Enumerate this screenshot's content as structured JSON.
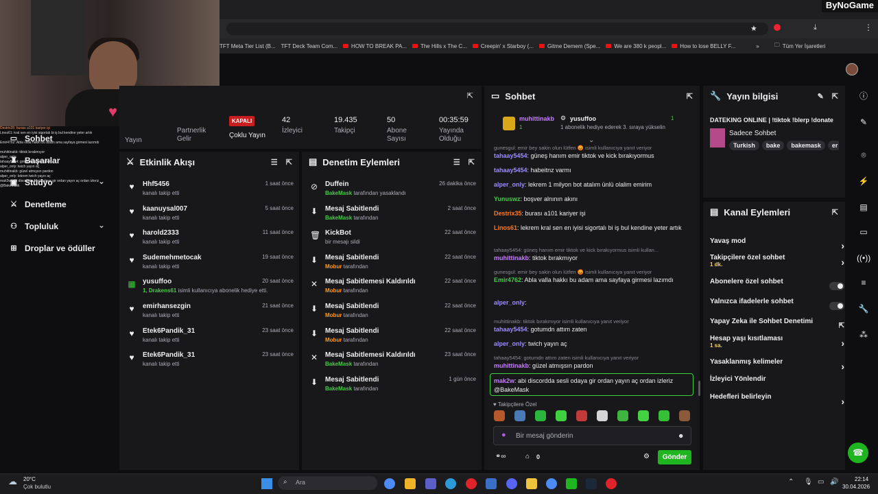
{
  "brand_watermark": "ByNoGame",
  "bookmarks": [
    "TFT Meta Tier List (B...",
    "TFT Deck Team Com...",
    "HOW TO BREAK PA...",
    "The Hills x The C...",
    "Creepin' x Starboy (...",
    "Gitme Demem (Spe...",
    "We are 380 k peopl...",
    "How to lose BELLY F..."
  ],
  "all_bookmarks": "Tüm Yer İşaretleri",
  "sidebar": {
    "items": [
      {
        "label": "Sohbet",
        "icon": "chat-icon"
      },
      {
        "label": "Başarılar",
        "icon": "trophy-icon"
      },
      {
        "label": "Stüdyo",
        "icon": "studio-icon"
      },
      {
        "label": "Denetleme",
        "icon": "sword-icon"
      },
      {
        "label": "Topluluk",
        "icon": "community-icon"
      },
      {
        "label": "Droplar ve ödüller",
        "icon": "gift-icon"
      }
    ],
    "overlay_chat": [
      "Destrix35: burası a101 kariyer işi",
      "Linos61: kral sen en iyisi sigortalı bi iş bul kendine yeter artık",
      "Emir4762: Abla valla hakkı bu adam ama sayfaya girmesi lazımdı",
      "muhittinakb: tiktok bırakmıyor",
      "alper_only:",
      "tahaay5454: gotumdn attım zaten",
      "alper_only: twich yayın aç",
      "muhittinakb: güzel atmışsın pardon",
      "alper_only: lekrem twich yayın aç",
      "mak2w: abi discordda sesli odaya gir ordan yayın aç ordan izleriz @BakeMask"
    ]
  },
  "stream_stats": {
    "partial_label": "Yayın",
    "partner_label": "Partnerlik Gelir",
    "multistream_badge": "KAPALI",
    "multistream_label": "Çoklu Yayın",
    "viewers_value": "42",
    "viewers_label": "İzleyici",
    "followers_value": "19.435",
    "followers_label": "Takipçi",
    "subs_value": "50",
    "subs_label": "Abone Sayısı",
    "uptime_value": "00:35:59",
    "uptime_label": "Yayında Olduğu"
  },
  "activity_feed": {
    "title": "Etkinlik Akışı",
    "items": [
      {
        "name": "Hhf5456",
        "desc": "kanalı takip etti",
        "time": "1 saat önce",
        "icon": "heart-icon"
      },
      {
        "name": "kaanuysal007",
        "desc": "kanalı takip etti",
        "time": "5 saat önce",
        "icon": "heart-icon"
      },
      {
        "name": "harold2333",
        "desc": "kanalı takip etti",
        "time": "11 saat önce",
        "icon": "heart-icon"
      },
      {
        "name": "Sudemehmetocak",
        "desc": "kanalı takip etti",
        "time": "19 saat önce",
        "icon": "heart-icon"
      },
      {
        "name": "yusuffoo",
        "desc_green": "1, Drakens61",
        "desc": "isimli kullanıcıya abonelik hediye etti.",
        "time": "20 saat önce",
        "icon": "gift-icon"
      },
      {
        "name": "emirhansezgin",
        "desc": "kanalı takip etti",
        "time": "21 saat önce",
        "icon": "heart-icon"
      },
      {
        "name": "Etek6Pandik_31",
        "desc": "kanalı takip etti",
        "time": "23 saat önce",
        "icon": "heart-icon"
      },
      {
        "name": "Etek6Pandik_31",
        "desc": "kanalı takip etti",
        "time": "23 saat önce",
        "icon": "heart-icon"
      }
    ]
  },
  "mod_actions": {
    "title": "Denetim Eylemleri",
    "items": [
      {
        "action": "Duffein",
        "by": "BakeMask",
        "suffix": "tarafından yasaklandı",
        "time": "26 dakika önce",
        "icon": "ban-icon"
      },
      {
        "action": "Mesaj Sabitlendi",
        "by": "BakeMask",
        "suffix": "tarafından",
        "time": "2 saat önce",
        "icon": "pin-icon"
      },
      {
        "action": "KickBot",
        "by": "",
        "suffix": "bir mesajı sildi",
        "time": "22 saat önce",
        "icon": "trash-icon"
      },
      {
        "action": "Mesaj Sabitlendi",
        "by": "Mobur",
        "suffix": "tarafından",
        "time": "22 saat önce",
        "icon": "pin-icon"
      },
      {
        "action": "Mesaj Sabitlemesi Kaldırıldı",
        "by": "Mobur",
        "suffix": "tarafından",
        "time": "22 saat önce",
        "icon": "unpin-icon"
      },
      {
        "action": "Mesaj Sabitlendi",
        "by": "Mobur",
        "suffix": "tarafından",
        "time": "22 saat önce",
        "icon": "pin-icon"
      },
      {
        "action": "Mesaj Sabitlendi",
        "by": "Mobur",
        "suffix": "tarafından",
        "time": "22 saat önce",
        "icon": "pin-icon"
      },
      {
        "action": "Mesaj Sabitlemesi Kaldırıldı",
        "by": "BakeMask",
        "suffix": "tarafından",
        "time": "23 saat önce",
        "icon": "unpin-icon"
      },
      {
        "action": "Mesaj Sabitlendi",
        "by": "BakeMask",
        "suffix": "tarafından",
        "time": "1 gün önce",
        "icon": "pin-icon"
      }
    ]
  },
  "chat": {
    "title": "Sohbet",
    "pinned_user1": "muhittinakb",
    "pinned_user2": "yusuffoo",
    "pinned_count": "1",
    "pinned_sub": "1 abonelik hediye ederek 3. sıraya yükselin",
    "messages": [
      {
        "type": "reply",
        "text": "gunesgul: emir bey sakin olun lütfen 😡 isimli kullanıcıya yanıt veriyor"
      },
      {
        "user": "tahaay5454",
        "color": "#9b8cff",
        "text": "güneş hanım emir tiktok ve kick bırakıyormus"
      },
      {
        "user": "tahaay5454",
        "color": "#9b8cff",
        "text": "habeitnz varmı"
      },
      {
        "user": "alper_only",
        "color": "#9b8cff",
        "text": "lekrem 1 milyon bot atalım ünlü olalim emirim"
      },
      {
        "user": "Yunuswz",
        "color": "#3fd13f",
        "text": "boşver alnının akını"
      },
      {
        "user": "Destrix35",
        "color": "#ff7a1a",
        "text": "burası a101 kariyer işi"
      },
      {
        "user": "Linos61",
        "color": "#ff7a1a",
        "text": "lekrem kral sen en iyisi sigortalı bi iş bul kendine yeter artık"
      },
      {
        "type": "reply",
        "text": "tahaay5454: güneş hanım emir tiktok ve kick bırakıyormus isimli kullan..."
      },
      {
        "user": "muhittinakb",
        "color": "#c77dff",
        "text": "tiktok bırakmıyor"
      },
      {
        "type": "reply",
        "text": "gunesgul: emir bey sakin olun lütfen 😡 isimli kullanıcıya yanıt veriyor"
      },
      {
        "user": "Emir4762",
        "color": "#3fd13f",
        "text": "Abla valla hakkı bu adam ama sayfaya girmesi lazımdı"
      },
      {
        "user": "alper_only",
        "color": "#9b8cff",
        "text": ""
      },
      {
        "type": "reply",
        "text": "muhittinakb: tiktok bırakmıyor isimli kullanıcıya yanıt veriyor"
      },
      {
        "user": "tahaay5454",
        "color": "#9b8cff",
        "text": "gotumdn attım zaten"
      },
      {
        "user": "alper_only",
        "color": "#9b8cff",
        "text": "twich yayın aç"
      },
      {
        "type": "reply",
        "text": "tahaay5454: gotumdn attım zaten isimli kullanıcıya yanıt veriyor"
      },
      {
        "user": "muhittinakb",
        "color": "#c77dff",
        "text": "güzel atmışsın pardon"
      },
      {
        "user": "alper_only",
        "color": "#9b8cff",
        "text": "lekrem twich yayın aç"
      }
    ],
    "highlight_user": "mak2w",
    "highlight_text": "abi discordda sesli odaya gir ordan yayın aç ordan izleriz @BakeMask",
    "followers_only": "Takipçilere Özel",
    "input_placeholder": "Bir mesaj gönderin",
    "points_value": "0",
    "send_label": "Gönder"
  },
  "stream_info": {
    "title": "Yayın bilgisi",
    "stream_title": "DATEKING ONLINE | !tiktok !blerp !donate",
    "category": "Sadece Sohbet",
    "tags": [
      "Turkish",
      "bake",
      "bakemask",
      "er"
    ]
  },
  "channel_actions": {
    "title": "Kanal Eylemleri",
    "items": [
      {
        "label": "Yavaş mod",
        "sub": "",
        "control": "chevron"
      },
      {
        "label": "Takipçilere özel sohbet",
        "sub": "1 dk.",
        "control": "chevron"
      },
      {
        "label": "Abonelere özel sohbet",
        "sub": "",
        "control": "toggle"
      },
      {
        "label": "Yalnızca ifadelerle sohbet",
        "sub": "",
        "control": "toggle"
      },
      {
        "label": "Yapay Zeka ile Sohbet Denetimi",
        "sub": "",
        "control": "external"
      },
      {
        "label": "Hesap yaşı kısıtlaması",
        "sub": "1 sa.",
        "control": "chevron"
      },
      {
        "label": "Yasaklanmış kelimeler",
        "sub": "",
        "control": "chevron"
      },
      {
        "label": "İzleyici Yönlendir",
        "sub": "",
        "control": "none"
      },
      {
        "label": "Hedefleri belirleyin",
        "sub": "",
        "control": "chevron"
      }
    ]
  },
  "taskbar": {
    "weather_temp": "20°C",
    "weather_desc": "Çok bulutlu",
    "search_placeholder": "Ara",
    "time": "22:14",
    "date": "30.04.2026"
  }
}
